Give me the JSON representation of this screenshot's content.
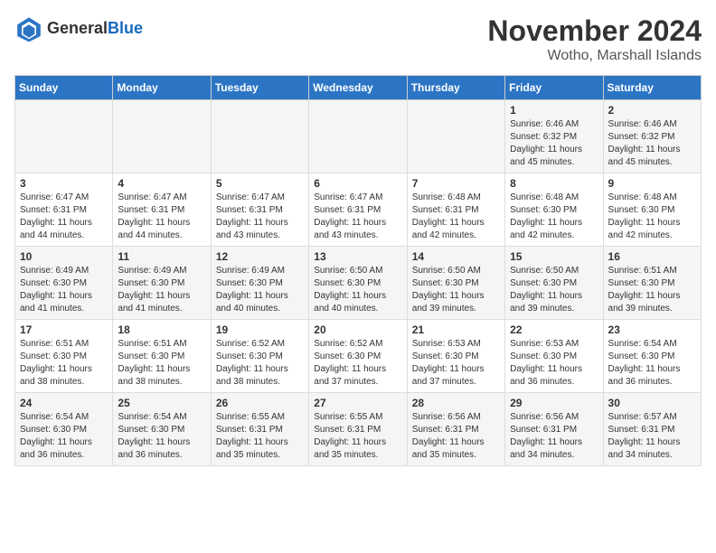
{
  "header": {
    "logo_general": "General",
    "logo_blue": "Blue",
    "month_title": "November 2024",
    "location": "Wotho, Marshall Islands"
  },
  "days_of_week": [
    "Sunday",
    "Monday",
    "Tuesday",
    "Wednesday",
    "Thursday",
    "Friday",
    "Saturday"
  ],
  "weeks": [
    [
      {
        "day": "",
        "info": ""
      },
      {
        "day": "",
        "info": ""
      },
      {
        "day": "",
        "info": ""
      },
      {
        "day": "",
        "info": ""
      },
      {
        "day": "",
        "info": ""
      },
      {
        "day": "1",
        "info": "Sunrise: 6:46 AM\nSunset: 6:32 PM\nDaylight: 11 hours and 45 minutes."
      },
      {
        "day": "2",
        "info": "Sunrise: 6:46 AM\nSunset: 6:32 PM\nDaylight: 11 hours and 45 minutes."
      }
    ],
    [
      {
        "day": "3",
        "info": "Sunrise: 6:47 AM\nSunset: 6:31 PM\nDaylight: 11 hours and 44 minutes."
      },
      {
        "day": "4",
        "info": "Sunrise: 6:47 AM\nSunset: 6:31 PM\nDaylight: 11 hours and 44 minutes."
      },
      {
        "day": "5",
        "info": "Sunrise: 6:47 AM\nSunset: 6:31 PM\nDaylight: 11 hours and 43 minutes."
      },
      {
        "day": "6",
        "info": "Sunrise: 6:47 AM\nSunset: 6:31 PM\nDaylight: 11 hours and 43 minutes."
      },
      {
        "day": "7",
        "info": "Sunrise: 6:48 AM\nSunset: 6:31 PM\nDaylight: 11 hours and 42 minutes."
      },
      {
        "day": "8",
        "info": "Sunrise: 6:48 AM\nSunset: 6:30 PM\nDaylight: 11 hours and 42 minutes."
      },
      {
        "day": "9",
        "info": "Sunrise: 6:48 AM\nSunset: 6:30 PM\nDaylight: 11 hours and 42 minutes."
      }
    ],
    [
      {
        "day": "10",
        "info": "Sunrise: 6:49 AM\nSunset: 6:30 PM\nDaylight: 11 hours and 41 minutes."
      },
      {
        "day": "11",
        "info": "Sunrise: 6:49 AM\nSunset: 6:30 PM\nDaylight: 11 hours and 41 minutes."
      },
      {
        "day": "12",
        "info": "Sunrise: 6:49 AM\nSunset: 6:30 PM\nDaylight: 11 hours and 40 minutes."
      },
      {
        "day": "13",
        "info": "Sunrise: 6:50 AM\nSunset: 6:30 PM\nDaylight: 11 hours and 40 minutes."
      },
      {
        "day": "14",
        "info": "Sunrise: 6:50 AM\nSunset: 6:30 PM\nDaylight: 11 hours and 39 minutes."
      },
      {
        "day": "15",
        "info": "Sunrise: 6:50 AM\nSunset: 6:30 PM\nDaylight: 11 hours and 39 minutes."
      },
      {
        "day": "16",
        "info": "Sunrise: 6:51 AM\nSunset: 6:30 PM\nDaylight: 11 hours and 39 minutes."
      }
    ],
    [
      {
        "day": "17",
        "info": "Sunrise: 6:51 AM\nSunset: 6:30 PM\nDaylight: 11 hours and 38 minutes."
      },
      {
        "day": "18",
        "info": "Sunrise: 6:51 AM\nSunset: 6:30 PM\nDaylight: 11 hours and 38 minutes."
      },
      {
        "day": "19",
        "info": "Sunrise: 6:52 AM\nSunset: 6:30 PM\nDaylight: 11 hours and 38 minutes."
      },
      {
        "day": "20",
        "info": "Sunrise: 6:52 AM\nSunset: 6:30 PM\nDaylight: 11 hours and 37 minutes."
      },
      {
        "day": "21",
        "info": "Sunrise: 6:53 AM\nSunset: 6:30 PM\nDaylight: 11 hours and 37 minutes."
      },
      {
        "day": "22",
        "info": "Sunrise: 6:53 AM\nSunset: 6:30 PM\nDaylight: 11 hours and 36 minutes."
      },
      {
        "day": "23",
        "info": "Sunrise: 6:54 AM\nSunset: 6:30 PM\nDaylight: 11 hours and 36 minutes."
      }
    ],
    [
      {
        "day": "24",
        "info": "Sunrise: 6:54 AM\nSunset: 6:30 PM\nDaylight: 11 hours and 36 minutes."
      },
      {
        "day": "25",
        "info": "Sunrise: 6:54 AM\nSunset: 6:30 PM\nDaylight: 11 hours and 36 minutes."
      },
      {
        "day": "26",
        "info": "Sunrise: 6:55 AM\nSunset: 6:31 PM\nDaylight: 11 hours and 35 minutes."
      },
      {
        "day": "27",
        "info": "Sunrise: 6:55 AM\nSunset: 6:31 PM\nDaylight: 11 hours and 35 minutes."
      },
      {
        "day": "28",
        "info": "Sunrise: 6:56 AM\nSunset: 6:31 PM\nDaylight: 11 hours and 35 minutes."
      },
      {
        "day": "29",
        "info": "Sunrise: 6:56 AM\nSunset: 6:31 PM\nDaylight: 11 hours and 34 minutes."
      },
      {
        "day": "30",
        "info": "Sunrise: 6:57 AM\nSunset: 6:31 PM\nDaylight: 11 hours and 34 minutes."
      }
    ]
  ]
}
